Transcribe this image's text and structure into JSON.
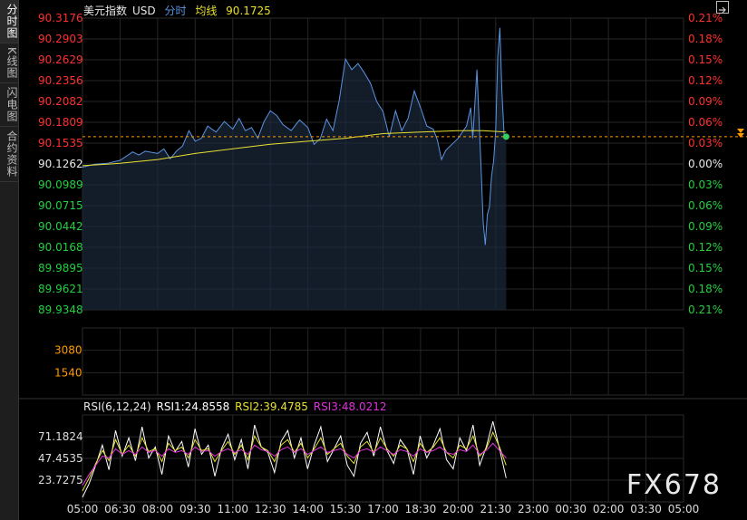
{
  "sidebar": {
    "tabs": [
      {
        "label": "分时图",
        "active": true
      },
      {
        "label": "K线图",
        "active": false
      },
      {
        "label": "闪电图",
        "active": false
      },
      {
        "label": "合约资料",
        "active": false
      }
    ]
  },
  "header": {
    "name": "美元指数",
    "currency": "USD",
    "mode": "分时",
    "avg_label": "均线",
    "avg_value": "90.1725"
  },
  "rsi_header": {
    "label": "RSI(6,12,24)",
    "rsi1": "RSI1:24.8558",
    "rsi2": "RSI2:39.4785",
    "rsi3": "RSI3:48.0212"
  },
  "watermark": "FX678",
  "colors": {
    "price_line": "#5b93e0",
    "avg_line": "#e8e030",
    "up": "#ff3030",
    "down": "#22d040",
    "ref_line": "#ff9900",
    "vol_label": "#ff9900",
    "rsi1": "#ffffff",
    "rsi2": "#e8e030",
    "rsi3": "#e030e0"
  },
  "chart_data": [
    {
      "type": "line",
      "title": "美元指数 USD 分时",
      "x": [
        "05:00",
        "06:30",
        "08:00",
        "09:30",
        "11:00",
        "12:30",
        "14:00",
        "15:30",
        "17:00",
        "18:30",
        "20:00",
        "21:30",
        "23:00",
        "00:30",
        "02:00",
        "03:30",
        "05:00"
      ],
      "price_ticks": [
        "90.3176",
        "90.2903",
        "90.2629",
        "90.2356",
        "90.2082",
        "90.1809",
        "90.1535",
        "90.1262",
        "90.0989",
        "90.0715",
        "90.0442",
        "90.0168",
        "89.9895",
        "89.9621",
        "89.9348"
      ],
      "pct_ticks": [
        "0.21%",
        "0.18%",
        "0.15%",
        "0.12%",
        "0.09%",
        "0.06%",
        "0.03%",
        "0.00%",
        "0.03%",
        "0.06%",
        "0.09%",
        "0.12%",
        "0.15%",
        "0.18%",
        "0.21%"
      ],
      "ylim": [
        89.9348,
        90.3176
      ],
      "prev_close": 90.1262,
      "series": [
        {
          "name": "分时",
          "points": [
            [
              "05:00",
              90.122
            ],
            [
              "05:30",
              90.126
            ],
            [
              "06:00",
              90.127
            ],
            [
              "06:30",
              90.131
            ],
            [
              "07:00",
              90.142
            ],
            [
              "07:15",
              90.138
            ],
            [
              "07:30",
              90.143
            ],
            [
              "08:00",
              90.14
            ],
            [
              "08:15",
              90.146
            ],
            [
              "08:30",
              90.133
            ],
            [
              "08:45",
              90.143
            ],
            [
              "09:00",
              90.15
            ],
            [
              "09:15",
              90.17
            ],
            [
              "09:30",
              90.156
            ],
            [
              "09:45",
              90.16
            ],
            [
              "10:00",
              90.176
            ],
            [
              "10:20",
              90.168
            ],
            [
              "10:40",
              90.182
            ],
            [
              "11:00",
              90.172
            ],
            [
              "11:15",
              90.186
            ],
            [
              "11:30",
              90.17
            ],
            [
              "11:45",
              90.174
            ],
            [
              "12:00",
              90.16
            ],
            [
              "12:15",
              90.182
            ],
            [
              "12:30",
              90.196
            ],
            [
              "12:45",
              90.19
            ],
            [
              "13:00",
              90.178
            ],
            [
              "13:20",
              90.17
            ],
            [
              "13:40",
              90.184
            ],
            [
              "14:00",
              90.174
            ],
            [
              "14:15",
              90.152
            ],
            [
              "14:30",
              90.16
            ],
            [
              "14:45",
              90.185
            ],
            [
              "15:00",
              90.17
            ],
            [
              "15:15",
              90.21
            ],
            [
              "15:30",
              90.264
            ],
            [
              "15:45",
              90.25
            ],
            [
              "16:00",
              90.258
            ],
            [
              "16:15",
              90.246
            ],
            [
              "16:30",
              90.232
            ],
            [
              "16:45",
              90.208
            ],
            [
              "17:00",
              90.195
            ],
            [
              "17:15",
              90.162
            ],
            [
              "17:30",
              90.196
            ],
            [
              "17:45",
              90.17
            ],
            [
              "18:00",
              90.186
            ],
            [
              "18:15",
              90.222
            ],
            [
              "18:30",
              90.2
            ],
            [
              "18:45",
              90.176
            ],
            [
              "19:00",
              90.172
            ],
            [
              "19:10",
              90.158
            ],
            [
              "19:20",
              90.132
            ],
            [
              "19:30",
              90.144
            ],
            [
              "19:45",
              90.152
            ],
            [
              "20:00",
              90.16
            ],
            [
              "20:10",
              90.168
            ],
            [
              "20:20",
              90.176
            ],
            [
              "20:30",
              90.2
            ],
            [
              "20:35",
              90.16
            ],
            [
              "20:45",
              90.25
            ],
            [
              "20:55",
              90.12
            ],
            [
              "21:00",
              90.05
            ],
            [
              "21:05",
              90.02
            ],
            [
              "21:10",
              90.06
            ],
            [
              "21:15",
              90.07
            ],
            [
              "21:20",
              90.11
            ],
            [
              "21:25",
              90.13
            ],
            [
              "21:30",
              90.17
            ],
            [
              "21:35",
              90.268
            ],
            [
              "21:40",
              90.305
            ],
            [
              "21:45",
              90.22
            ],
            [
              "21:50",
              90.166
            ],
            [
              "21:55",
              90.162
            ]
          ]
        },
        {
          "name": "均线",
          "points": [
            [
              "05:00",
              90.124
            ],
            [
              "06:30",
              90.127
            ],
            [
              "08:00",
              90.132
            ],
            [
              "09:30",
              90.14
            ],
            [
              "11:00",
              90.146
            ],
            [
              "12:30",
              90.152
            ],
            [
              "14:00",
              90.156
            ],
            [
              "15:30",
              90.16
            ],
            [
              "17:00",
              90.166
            ],
            [
              "18:30",
              90.168
            ],
            [
              "20:00",
              90.17
            ],
            [
              "21:00",
              90.17
            ],
            [
              "21:55",
              90.168
            ]
          ]
        }
      ]
    },
    {
      "type": "bar",
      "title": "",
      "tick_labels": [
        "3080",
        "1540"
      ],
      "ylim": [
        0,
        4620
      ],
      "values": []
    },
    {
      "type": "line",
      "title": "RSI(6,12,24)",
      "tick_labels": [
        "71.1824",
        "47.4535",
        "23.7275"
      ],
      "ylim": [
        0,
        95
      ],
      "series": [
        {
          "name": "RSI1",
          "values": [
            5,
            20,
            40,
            62,
            35,
            78,
            50,
            70,
            45,
            82,
            48,
            60,
            30,
            72,
            55,
            66,
            38,
            80,
            52,
            62,
            28,
            58,
            74,
            46,
            68,
            36,
            84,
            60,
            54,
            32,
            66,
            78,
            48,
            70,
            36,
            62,
            82,
            44,
            58,
            72,
            40,
            28,
            64,
            76,
            50,
            82,
            56,
            42,
            68,
            58,
            30,
            72,
            48,
            62,
            80,
            46,
            36,
            70,
            56,
            84,
            40,
            60,
            88,
            58,
            26
          ]
        },
        {
          "name": "RSI2",
          "values": [
            12,
            26,
            42,
            56,
            45,
            68,
            52,
            62,
            50,
            70,
            55,
            58,
            44,
            64,
            56,
            60,
            48,
            68,
            56,
            58,
            44,
            56,
            66,
            52,
            62,
            46,
            72,
            60,
            56,
            44,
            62,
            68,
            54,
            64,
            48,
            58,
            70,
            52,
            58,
            64,
            50,
            42,
            60,
            66,
            54,
            70,
            58,
            50,
            62,
            58,
            44,
            64,
            54,
            60,
            70,
            54,
            48,
            62,
            58,
            72,
            50,
            58,
            76,
            60,
            40
          ]
        },
        {
          "name": "RSI3",
          "values": [
            18,
            30,
            40,
            50,
            48,
            58,
            52,
            56,
            52,
            60,
            54,
            56,
            50,
            58,
            54,
            56,
            52,
            60,
            55,
            56,
            50,
            55,
            58,
            54,
            57,
            52,
            62,
            57,
            55,
            50,
            57,
            60,
            54,
            58,
            52,
            56,
            60,
            54,
            56,
            58,
            52,
            48,
            56,
            58,
            54,
            60,
            56,
            52,
            57,
            55,
            50,
            58,
            54,
            56,
            60,
            54,
            52,
            57,
            55,
            62,
            52,
            56,
            64,
            56,
            48
          ]
        }
      ]
    }
  ]
}
